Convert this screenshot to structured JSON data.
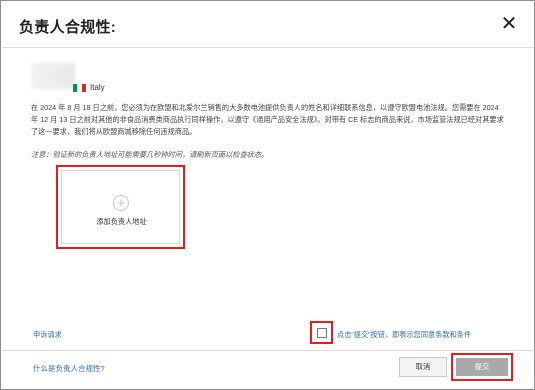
{
  "dialog": {
    "title": "负责人合规性:",
    "close_glyph": "✕"
  },
  "country": {
    "name": "Italy",
    "flag_colors": [
      "#009246",
      "#ffffff",
      "#ce2b37"
    ]
  },
  "content": {
    "paragraph": "在 2024 年 8 月 18 日之前，您必须为在欧盟和北爱尔兰销售的大多数电池提供负责人的姓名和详细联系信息，以遵守欧盟电池法规。您需要在 2024 年 12 月 13 日之前对其他的非食品消费类商品执行同样操作，以遵守《通用产品安全法规》。对带有 CE 标志的商品来说，市场监管法规已经对其要求了这一要求，我们将从欧盟商城移除任何违规商品。",
    "note": "注意：验证新的负责人地址可能需要几秒钟时间，请刷新页面以检查状态。"
  },
  "address_card": {
    "plus_glyph": "+",
    "label": "添加负责人地址"
  },
  "footer": {
    "appeal_link": "申诉请求",
    "agree_text": "点击“提交”按钮，即表示您同意条款和条件",
    "what_link": "什么是负责人合规性?",
    "cancel_label": "取消",
    "submit_label": "提交"
  },
  "colors": {
    "highlight": "#e02020",
    "link": "#2a6fb8",
    "submit_disabled": "#a9a9a9"
  }
}
